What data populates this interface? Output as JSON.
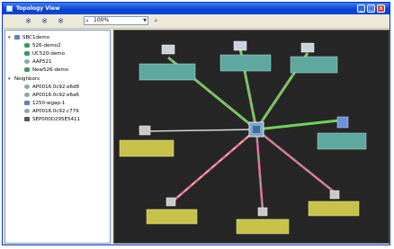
{
  "window": {
    "title": "Topology View"
  },
  "toolbar": {
    "zoom_value": "100%"
  },
  "tree": {
    "root_label": "SBC1demo",
    "root_children": [
      "526-demo2",
      "UC520-demo",
      "AAP521",
      "New526-demo"
    ],
    "neighbors_label": "Neighbors",
    "neighbors": [
      "AP0016.0c92.e6d8",
      "AP0016.0c92.e6a6",
      "1250-wgap-1",
      "AP0016.0c92.c779",
      "SEP000D295E5411"
    ]
  },
  "colors": {
    "canvas_bg": "#262626",
    "cyan_label": "#5fa8a0",
    "yellow_label": "#c9c24a",
    "link_green": "#6fd35a",
    "link_pink": "#e86aa8",
    "link_white": "#d8d8d8"
  }
}
